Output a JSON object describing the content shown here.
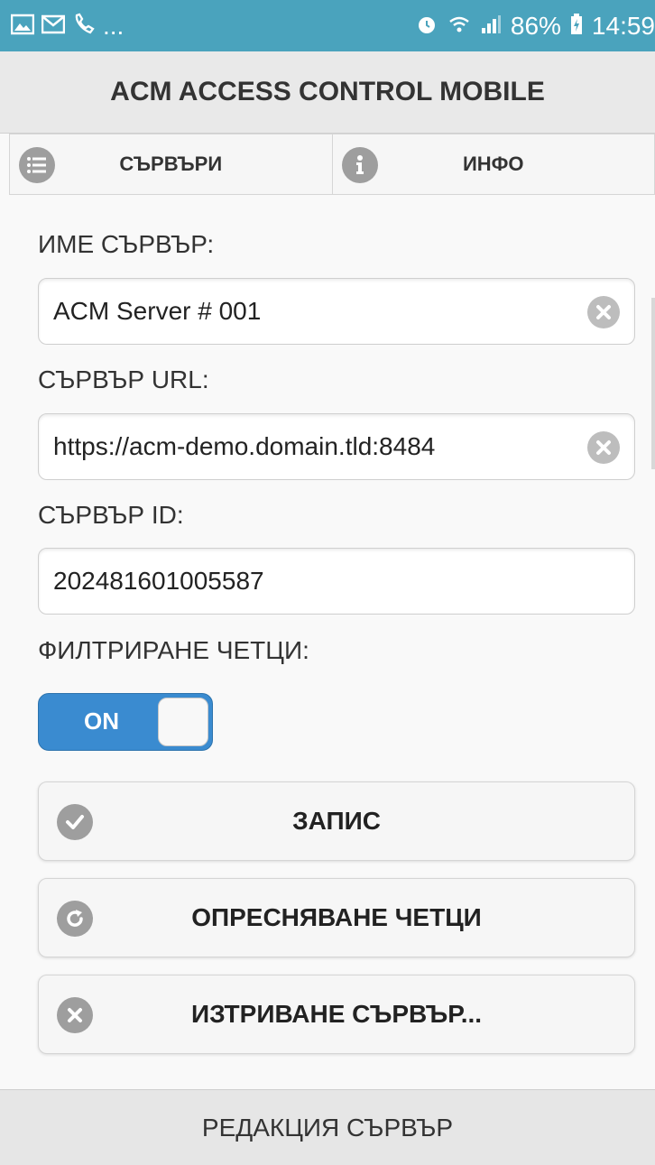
{
  "status_bar": {
    "icons_left": [
      "image-icon",
      "gmail-icon",
      "phone-icon"
    ],
    "more": "...",
    "icons_right": [
      "alarm-icon",
      "wifi-icon",
      "signal-icon"
    ],
    "battery": "86%",
    "time": "14:59"
  },
  "header": {
    "title": "ACM ACCESS CONTROL MOBILE"
  },
  "tabs": [
    {
      "label": "СЪРВЪРИ",
      "icon": "list-icon"
    },
    {
      "label": "ИНФО",
      "icon": "info-icon"
    }
  ],
  "form": {
    "server_name": {
      "label": "ИМЕ СЪРВЪР:",
      "value": "ACM Server # 001"
    },
    "server_url": {
      "label": "СЪРВЪР URL:",
      "value": "https://acm-demo.domain.tld:8484"
    },
    "server_id": {
      "label": "СЪРВЪР ID:",
      "value": "202481601005587"
    },
    "filter_readers": {
      "label": "ФИЛТРИРАНЕ ЧЕТЦИ:",
      "toggle": "ON"
    }
  },
  "buttons": {
    "save": "ЗАПИС",
    "refresh": "ОПРЕСНЯВАНЕ ЧЕТЦИ",
    "delete": "ИЗТРИВАНЕ СЪРВЪР..."
  },
  "footer": {
    "title": "РЕДАКЦИЯ СЪРВЪР"
  },
  "colors": {
    "status_bar": "#4aa3bd",
    "toggle_on": "#3a8bd0",
    "icon_gray": "#9e9e9e"
  }
}
